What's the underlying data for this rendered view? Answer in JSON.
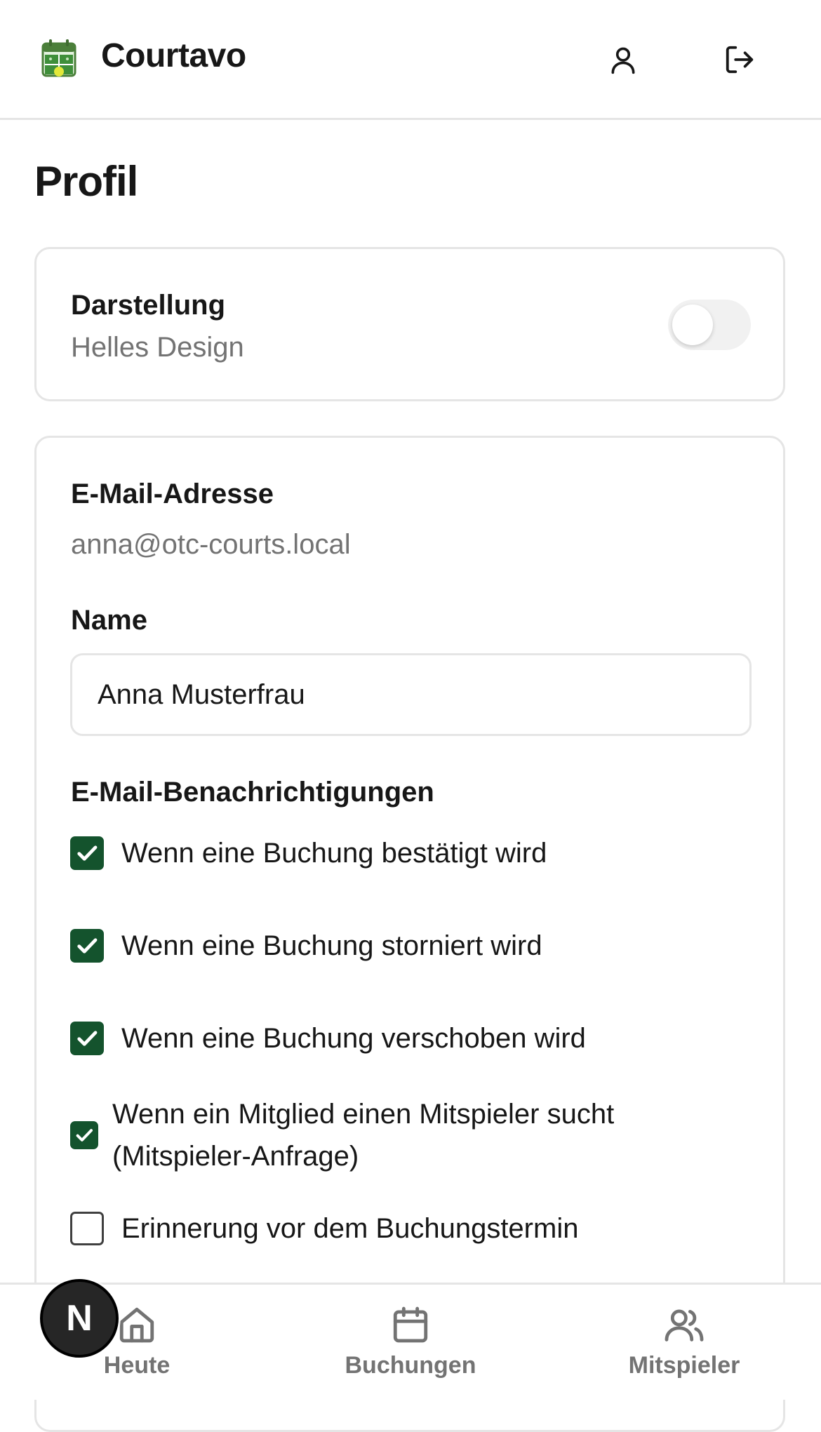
{
  "header": {
    "app_name": "Courtavo",
    "logo_icon": "court-calendar-icon",
    "user_icon": "user-icon",
    "logout_icon": "logout-icon"
  },
  "page": {
    "title": "Profil"
  },
  "appearance": {
    "label": "Darstellung",
    "subtitle": "Helles Design",
    "dark_mode_enabled": false
  },
  "account": {
    "email_label": "E-Mail-Adresse",
    "email_value": "anna@otc-courts.local",
    "name_label": "Name",
    "name_value": "Anna Musterfrau",
    "notifications_label": "E-Mail-Benachrichtigungen",
    "notifications": [
      {
        "label": "Wenn eine Buchung bestätigt wird",
        "checked": true
      },
      {
        "label": "Wenn eine Buchung storniert wird",
        "checked": true
      },
      {
        "label": "Wenn eine Buchung verschoben wird",
        "checked": true
      },
      {
        "label_line1": "Wenn ein Mitglied einen Mitspieler sucht",
        "label_line2": "(Mitspieler-Anfrage)",
        "checked": true
      },
      {
        "label": "Erinnerung vor dem Buchungstermin",
        "checked": false
      }
    ]
  },
  "bottom_nav": {
    "items": [
      {
        "label": "Heute",
        "icon": "home-icon"
      },
      {
        "label": "Buchungen",
        "icon": "calendar-icon"
      },
      {
        "label": "Mitspieler",
        "icon": "users-icon"
      }
    ]
  },
  "dev_badge": {
    "letter": "N"
  },
  "colors": {
    "accent": "#14532d",
    "muted_text": "#737373",
    "border": "#e5e5e5"
  }
}
